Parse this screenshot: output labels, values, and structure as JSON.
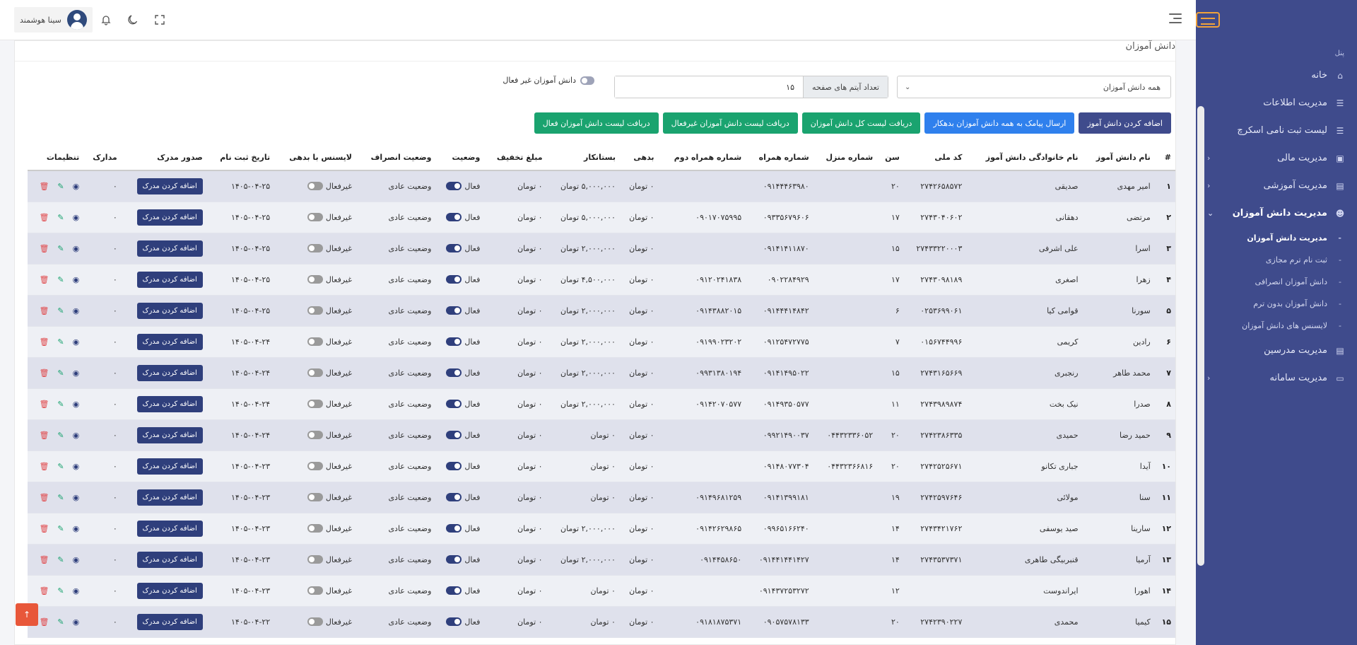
{
  "sidebar": {
    "section": "پنل",
    "items": [
      {
        "label": "خانه",
        "icon": "home-icon"
      },
      {
        "label": "مدیریت اطلاعات",
        "icon": "database-icon"
      },
      {
        "label": "لیست ثبت نامی اسکرچ",
        "icon": "database-icon"
      },
      {
        "label": "مدیریت مالی",
        "icon": "wallet-icon"
      },
      {
        "label": "مدیریت آموزشی",
        "icon": "book-icon"
      },
      {
        "label": "مدیریت دانش آموزان",
        "icon": "users-icon"
      }
    ],
    "subitems": [
      {
        "label": "مدیریت دانش آموزان"
      },
      {
        "label": "ثبت نام ترم مجازی"
      },
      {
        "label": "دانش آموزان انصرافی"
      },
      {
        "label": "دانش آموزان بدون ترم"
      },
      {
        "label": "لایسنس های دانش آموزان"
      }
    ],
    "items_after": [
      {
        "label": "مدیریت مدرسین",
        "icon": "book-icon"
      },
      {
        "label": "مدیریت سامانه",
        "icon": "monitor-icon"
      }
    ]
  },
  "topbar": {
    "user_name": "سینا هوشمند"
  },
  "page": {
    "title": "دانش آموزان"
  },
  "filters": {
    "select_value": "همه دانش آموزان",
    "page_size_label": "تعداد آیتم های صفحه",
    "page_size_value": "۱۵",
    "inactive_toggle_label": "دانش آموزان غیر فعال"
  },
  "actions": {
    "add_student": "اضافه کردن دانش آموز",
    "sms_debtors": "ارسال پیامک به همه دانش آموزان بدهکار",
    "all_list": "دریافت لیست کل دانش آموزان",
    "inactive_list": "دریافت لیست دانش آموزان غیرفعال",
    "active_list": "دریافت لیست دانش آموزان فعال"
  },
  "table": {
    "headers": [
      "#",
      "نام دانش آموز",
      "نام خانوادگی دانش آموز",
      "کد ملی",
      "سن",
      "شماره منزل",
      "شماره همراه",
      "شماره همراه دوم",
      "بدهی",
      "بستانکار",
      "مبلغ تخفیف",
      "وضعیت",
      "وضعیت انصراف",
      "لایسنس با بدهی",
      "تاریخ ثبت نام",
      "صدور مدرک",
      "مدارک",
      "تنظیمات"
    ],
    "status_on": "فعال",
    "license_off": "غیرفعال",
    "cancel_status": "وضعیت عادی",
    "certificate_btn": "اضافه کردن مدرک",
    "docs_value": "۰",
    "rows": [
      {
        "num": "۱",
        "first": "امیر مهدی",
        "last": "صدیقی",
        "nid": "۲۷۴۲۶۵۸۵۷۲",
        "age": "۲۰",
        "home": "",
        "mobile": "۰۹۱۴۴۴۶۳۹۸۰",
        "mobile2": "",
        "debt": "۰ تومان",
        "credit": "۵,۰۰۰,۰۰۰ تومان",
        "discount": "۰ تومان",
        "date": "۱۴۰۵-۰۴-۲۵"
      },
      {
        "num": "۲",
        "first": "مرتضی",
        "last": "دهقانی",
        "nid": "۲۷۴۳۰۴۰۶۰۲",
        "age": "۱۷",
        "home": "",
        "mobile": "۰۹۳۳۵۶۷۹۶۰۶",
        "mobile2": "۰۹۰۱۷۰۷۵۹۹۵",
        "debt": "۰ تومان",
        "credit": "۵,۰۰۰,۰۰۰ تومان",
        "discount": "۰ تومان",
        "date": "۱۴۰۵-۰۴-۲۵"
      },
      {
        "num": "۳",
        "first": "اسرا",
        "last": "علی اشرفی",
        "nid": "۲۷۴۳۳۲۲۰۰۰۳",
        "age": "۱۵",
        "home": "",
        "mobile": "۰۹۱۴۱۴۱۱۸۷۰",
        "mobile2": "",
        "debt": "۰ تومان",
        "credit": "۲,۰۰۰,۰۰۰ تومان",
        "discount": "۰ تومان",
        "date": "۱۴۰۵-۰۴-۲۵"
      },
      {
        "num": "۴",
        "first": "زهرا",
        "last": "اصغری",
        "nid": "۲۷۴۳۰۹۸۱۸۹",
        "age": "۱۷",
        "home": "",
        "mobile": "۰۹۰۲۲۸۴۹۲۹",
        "mobile2": "۰۹۱۲۰۲۴۱۸۳۸",
        "debt": "۰ تومان",
        "credit": "۴,۵۰۰,۰۰۰ تومان",
        "discount": "۰ تومان",
        "date": "۱۴۰۵-۰۴-۲۵"
      },
      {
        "num": "۵",
        "first": "سورنا",
        "last": "قوامی کیا",
        "nid": "۰۲۵۳۶۹۹۰۶۱",
        "age": "۶",
        "home": "",
        "mobile": "۰۹۱۴۴۴۱۴۸۴۲",
        "mobile2": "۰۹۱۴۳۸۸۲۰۱۵",
        "debt": "۰ تومان",
        "credit": "۲,۰۰۰,۰۰۰ تومان",
        "discount": "۰ تومان",
        "date": "۱۴۰۵-۰۴-۲۵"
      },
      {
        "num": "۶",
        "first": "رادین",
        "last": "کریمی",
        "nid": "۰۱۵۶۷۴۴۹۹۶",
        "age": "۷",
        "home": "",
        "mobile": "۰۹۱۲۵۴۷۲۷۷۵",
        "mobile2": "۰۹۱۹۹۰۲۳۲۰۲",
        "debt": "۰ تومان",
        "credit": "۲,۰۰۰,۰۰۰ تومان",
        "discount": "۰ تومان",
        "date": "۱۴۰۵-۰۴-۲۴"
      },
      {
        "num": "۷",
        "first": "محمد طاهر",
        "last": "رنجبری",
        "nid": "۲۷۴۳۱۶۵۶۶۹",
        "age": "۱۵",
        "home": "",
        "mobile": "۰۹۱۴۱۴۹۵۰۲۲",
        "mobile2": "۰۹۹۳۱۳۸۰۱۹۴",
        "debt": "۰ تومان",
        "credit": "۲,۰۰۰,۰۰۰ تومان",
        "discount": "۰ تومان",
        "date": "۱۴۰۵-۰۴-۲۴"
      },
      {
        "num": "۸",
        "first": "صدرا",
        "last": "نیک بخت",
        "nid": "۲۷۴۳۹۸۹۸۷۴",
        "age": "۱۱",
        "home": "",
        "mobile": "۰۹۱۴۹۳۵۰۵۷۷",
        "mobile2": "۰۹۱۴۲۰۷۰۵۷۷",
        "debt": "۰ تومان",
        "credit": "۲,۰۰۰,۰۰۰ تومان",
        "discount": "۰ تومان",
        "date": "۱۴۰۵-۰۴-۲۴"
      },
      {
        "num": "۹",
        "first": "حمید رضا",
        "last": "حمیدی",
        "nid": "۲۷۴۲۳۸۶۳۳۵",
        "age": "۲۰",
        "home": "۰۴۴۳۲۳۳۶۰۵۲",
        "mobile": "۰۹۹۲۱۴۹۰۰۳۷",
        "mobile2": "",
        "debt": "۰ تومان",
        "credit": "۰ تومان",
        "discount": "۰ تومان",
        "date": "۱۴۰۵-۰۴-۲۴"
      },
      {
        "num": "۱۰",
        "first": "آیدا",
        "last": "جباری تکانو",
        "nid": "۲۷۴۲۵۲۵۶۷۱",
        "age": "۲۰",
        "home": "۰۴۴۳۲۳۶۶۸۱۶",
        "mobile": "۰۹۱۴۸۰۷۷۳۰۴",
        "mobile2": "",
        "debt": "۰ تومان",
        "credit": "۰ تومان",
        "discount": "۰ تومان",
        "date": "۱۴۰۵-۰۴-۲۳"
      },
      {
        "num": "۱۱",
        "first": "سنا",
        "last": "مولائی",
        "nid": "۲۷۴۲۵۹۷۶۴۶",
        "age": "۱۹",
        "home": "",
        "mobile": "۰۹۱۴۱۳۹۹۱۸۱",
        "mobile2": "۰۹۱۴۹۶۸۱۲۵۹",
        "debt": "۰ تومان",
        "credit": "۰ تومان",
        "discount": "۰ تومان",
        "date": "۱۴۰۵-۰۴-۲۳"
      },
      {
        "num": "۱۲",
        "first": "سارینا",
        "last": "صید یوسفی",
        "nid": "۲۷۴۳۴۲۱۷۶۲",
        "age": "۱۴",
        "home": "",
        "mobile": "۰۹۹۶۵۱۶۶۲۴۰",
        "mobile2": "۰۹۱۴۲۶۲۹۸۶۵",
        "debt": "۰ تومان",
        "credit": "۲,۰۰۰,۰۰۰ تومان",
        "discount": "۰ تومان",
        "date": "۱۴۰۵-۰۴-۲۳"
      },
      {
        "num": "۱۳",
        "first": "آرمیا",
        "last": "قنبربیگی طاهری",
        "nid": "۲۷۴۳۵۳۷۳۷۱",
        "age": "۱۴",
        "home": "",
        "mobile": "۰۹۱۴۴۱۴۴۱۴۲۷",
        "mobile2": "۰۹۱۴۴۵۸۶۵۰",
        "debt": "۰ تومان",
        "credit": "۲,۰۰۰,۰۰۰ تومان",
        "discount": "۰ تومان",
        "date": "۱۴۰۵-۰۴-۲۳"
      },
      {
        "num": "۱۴",
        "first": "اهورا",
        "last": "ایراندوست",
        "nid": "",
        "age": "۱۲",
        "home": "",
        "mobile": "۰۹۱۴۳۷۲۵۳۲۷۲",
        "mobile2": "",
        "debt": "۰ تومان",
        "credit": "۰ تومان",
        "discount": "۰ تومان",
        "date": "۱۴۰۵-۰۴-۲۳"
      },
      {
        "num": "۱۵",
        "first": "کیمیا",
        "last": "محمدی",
        "nid": "۲۷۴۲۳۹۰۲۲۷",
        "age": "۲۰",
        "home": "",
        "mobile": "۰۹۰۵۷۵۷۸۱۳۳",
        "mobile2": "۰۹۱۸۱۸۷۵۳۷۱",
        "debt": "۰ تومان",
        "credit": "۰ تومان",
        "discount": "۰ تومان",
        "date": "۱۴۰۵-۰۴-۲۲"
      }
    ]
  }
}
